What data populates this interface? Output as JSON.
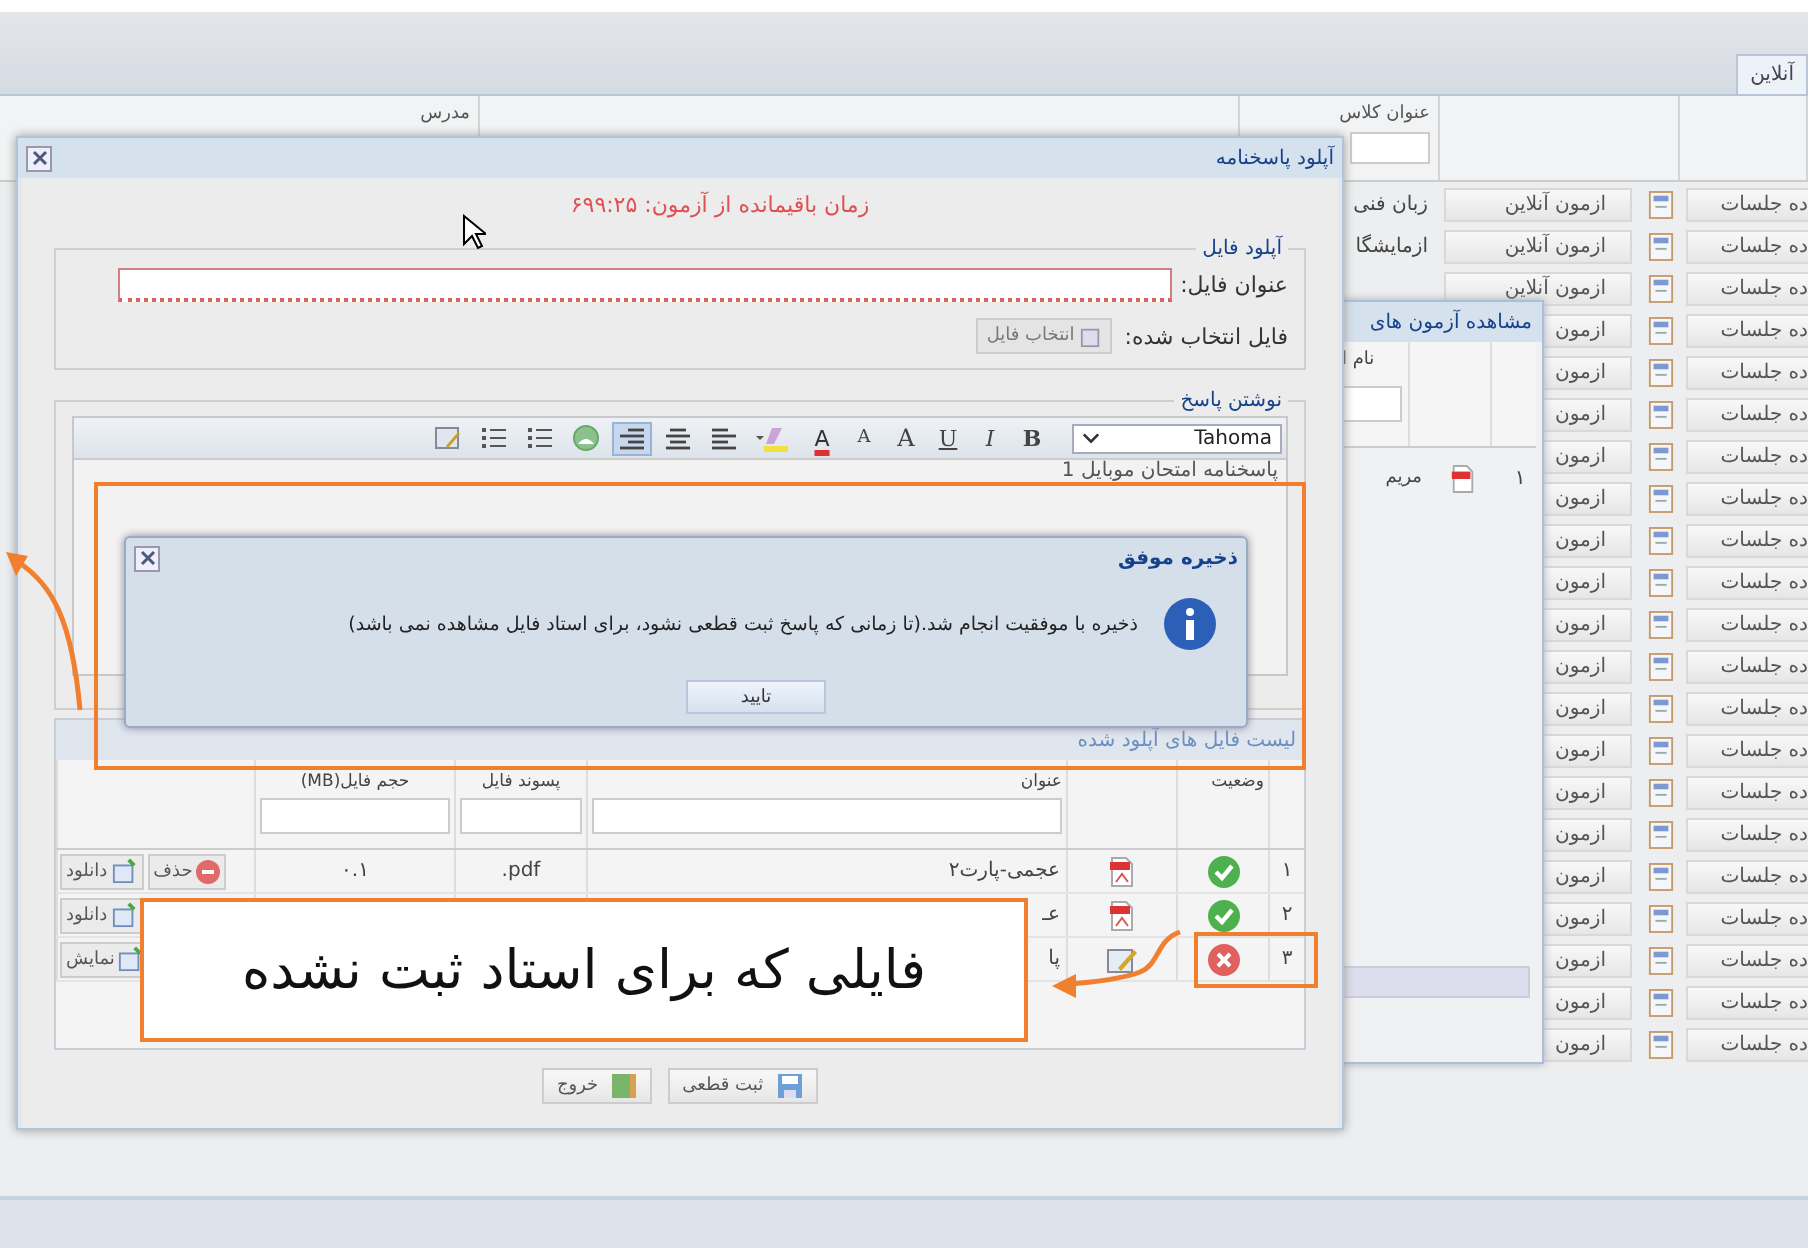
{
  "app": {
    "tab": "آنلاین",
    "columns": [
      {
        "label": "عنوان کلاس"
      },
      {
        "label": "مدرس"
      }
    ],
    "rows": [
      {
        "sessions_button": "ده جلسات",
        "exam_button": "ازمون آنلاین",
        "class_title": "زبان فنی"
      },
      {
        "sessions_button": "ده جلسات",
        "exam_button": "ازمون آنلاین",
        "class_title": "ازمایشگا"
      },
      {
        "sessions_button": "ده جلسات",
        "exam_button": "ازمون آنلاین"
      },
      {
        "sessions_button": "ده جلسات",
        "exam_button": "ازمون"
      },
      {
        "sessions_button": "ده جلسات",
        "exam_button": "ازمون"
      },
      {
        "sessions_button": "ده جلسات",
        "exam_button": "ازمون"
      },
      {
        "sessions_button": "ده جلسات",
        "exam_button": "ازمون"
      },
      {
        "sessions_button": "ده جلسات",
        "exam_button": "ازمون"
      },
      {
        "sessions_button": "ده جلسات",
        "exam_button": "ازمون"
      },
      {
        "sessions_button": "ده جلسات",
        "exam_button": "ازمون"
      },
      {
        "sessions_button": "ده جلسات",
        "exam_button": "ازمون"
      },
      {
        "sessions_button": "ده جلسات",
        "exam_button": "ازمون"
      },
      {
        "sessions_button": "ده جلسات",
        "exam_button": "ازمون"
      },
      {
        "sessions_button": "ده جلسات",
        "exam_button": "ازمون"
      },
      {
        "sessions_button": "ده جلسات",
        "exam_button": "ازمون"
      },
      {
        "sessions_button": "ده جلسات",
        "exam_button": "ازمون"
      },
      {
        "sessions_button": "ده جلسات",
        "exam_button": "ازمون"
      },
      {
        "sessions_button": "ده جلسات",
        "exam_button": "ازمون"
      },
      {
        "sessions_button": "ده جلسات",
        "exam_button": "ازمون"
      },
      {
        "sessions_button": "ده جلسات",
        "exam_button": "ازمون"
      },
      {
        "sessions_button": "ده جلسات",
        "exam_button": "ازمون"
      }
    ]
  },
  "exams_window": {
    "title": "مشاهده آزمون های",
    "column": "نام ا",
    "rows": [
      {
        "number": "۱",
        "name": "مریم"
      }
    ]
  },
  "dialog": {
    "title": "آپلود پاسخنامه",
    "timer": "زمان باقیمانده از آزمون: ۶۹۹:۲۵",
    "upload": {
      "legend": "آپلود فایل",
      "title_label": "عنوان فایل:",
      "title_invalid": true,
      "choose_button": "انتخاب فایل",
      "choose_disabled": true,
      "selected_label": "فایل انتخاب شده:"
    },
    "answer": {
      "legend": "نوشتن پاسخ",
      "font": "Tahoma",
      "text": "پاسخنامه امتحان موبایل 1",
      "toolbar": [
        {
          "kind": "bold",
          "label": "B",
          "selected": false
        },
        {
          "kind": "italic",
          "label": "I",
          "selected": false
        },
        {
          "kind": "underline",
          "label": "U",
          "selected": false
        },
        {
          "kind": "grow",
          "label": "A",
          "selected": false
        },
        {
          "kind": "shrink",
          "label": "A",
          "selected": false
        },
        {
          "kind": "color",
          "label": "A",
          "selected": false
        },
        {
          "kind": "highlight",
          "selected": false
        },
        {
          "kind": "align-left",
          "selected": false
        },
        {
          "kind": "align-center",
          "selected": false
        },
        {
          "kind": "align-right",
          "selected": true
        },
        {
          "kind": "image",
          "selected": false
        },
        {
          "kind": "numbered-list",
          "selected": false
        },
        {
          "kind": "bullet-list",
          "selected": false
        },
        {
          "kind": "source",
          "selected": false
        }
      ]
    },
    "files": {
      "title": "لیست فایل های آپلود شده",
      "columns": [
        "وضعیت",
        "عنوان",
        "پسوند فایل",
        "حجم فایل(MB)"
      ],
      "rows": [
        {
          "number": "۱",
          "registered": true,
          "file": {
            "kind": "pdf"
          },
          "title": "عجمی-پارت۲",
          "extension": "pdf.",
          "size": "۰.۱",
          "actions": [
            {
              "kind": "delete",
              "label": "حذف"
            },
            {
              "kind": "download",
              "label": "دانلود"
            }
          ]
        },
        {
          "number": "۲",
          "registered": true,
          "file": {
            "kind": "pdf"
          },
          "title": "عـ",
          "actions": [
            {
              "kind": "download",
              "label": "دانلود"
            }
          ]
        },
        {
          "number": "۳",
          "registered": false,
          "file": {
            "kind": "text"
          },
          "title": "پا",
          "actions": [
            {
              "kind": "view",
              "label": "نمایش"
            }
          ]
        }
      ]
    },
    "buttons": [
      {
        "kind": "save",
        "label": "ثبت قطعی"
      },
      {
        "kind": "exit",
        "label": "خروج"
      }
    ]
  },
  "message": {
    "title": "ذخیره موفق",
    "text": "ذخیره با موفقیت انجام شد.(تا زمانی که پاسخ ثبت قطعی نشود، برای استاد فایل مشاهده نمی باشد)",
    "button": "تایید"
  },
  "annotation": {
    "text": "فایلی که برای استاد ثبت نشده"
  }
}
